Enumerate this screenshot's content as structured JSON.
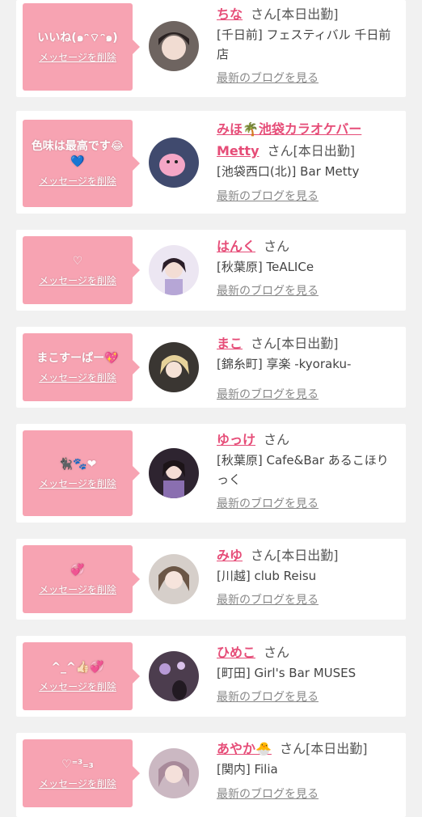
{
  "delete_label": "メッセージを削除",
  "san_label": "さん",
  "blog_label": "最新のブログを見る",
  "cards": [
    {
      "message": "いいね(๑ᵔ⌔ᵔ๑)",
      "name": "ちな",
      "status": "[本日出勤]",
      "shop": "[千日前] フェスティバル 千日前店"
    },
    {
      "message": "色味は最高です😂💙",
      "name": "みほ🌴池袋カラオケバー Metty",
      "status": "[本日出勤]",
      "shop": "[池袋西口(北)] Bar Metty"
    },
    {
      "message": "♡",
      "name": "はんく",
      "status": "",
      "shop": "[秋葉原] TeALICe"
    },
    {
      "message": "まこすーぱー💖",
      "name": "まこ",
      "status": "[本日出勤]",
      "shop": "[錦糸町] 享楽 -kyoraku-"
    },
    {
      "message": "🐈‍⬛🐾❤",
      "name": "ゆっけ",
      "status": "",
      "shop": "[秋葉原] Cafe&Bar あるこほりっく"
    },
    {
      "message": "💞",
      "name": "みゆ",
      "status": "[本日出勤]",
      "shop": "[川越] club Reisu"
    },
    {
      "message": "^_^👍🏻💞",
      "name": "ひめこ",
      "status": "",
      "shop": "[町田] Girl's Bar MUSES"
    },
    {
      "message": "♡⁼³₌₃",
      "name": "あやか🐣",
      "status": "[本日出勤]",
      "shop": "[関内] Filia"
    }
  ],
  "colors": {
    "accent": "#e64d78",
    "bubble": "#f7a3b2",
    "background": "#f1f1f1"
  }
}
